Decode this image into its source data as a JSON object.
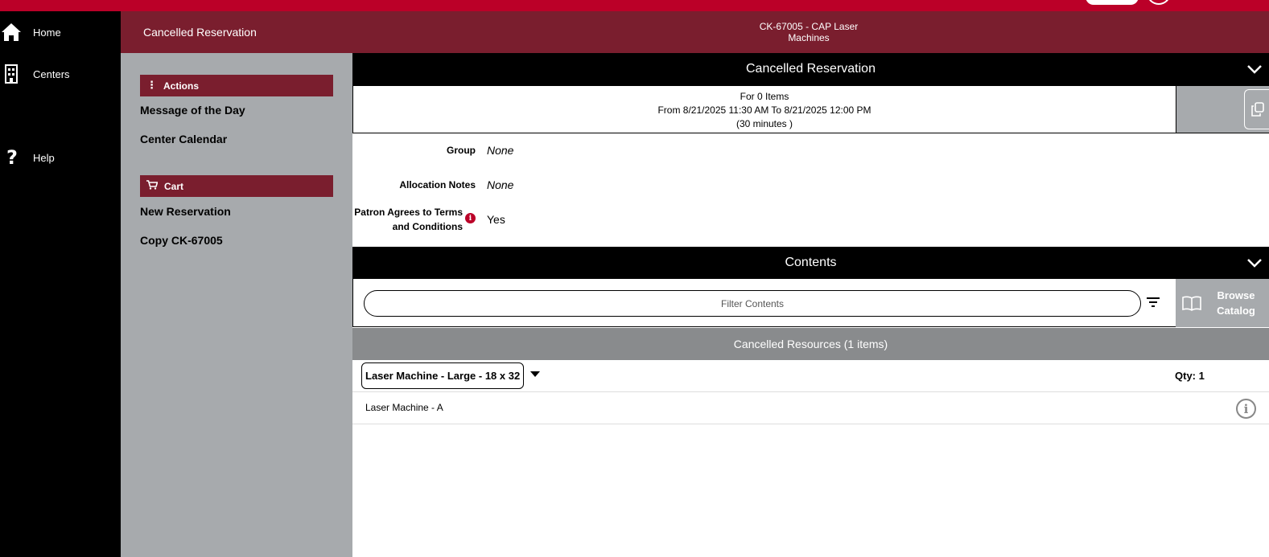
{
  "header": {
    "page_title": "Cancelled Reservation",
    "center_title": "CK-67005 - CAP Laser Machines"
  },
  "nav": {
    "items": [
      {
        "label": "Home",
        "icon": "home-icon"
      },
      {
        "label": "Centers",
        "icon": "building-icon"
      },
      {
        "label": "Help",
        "icon": "help-icon"
      }
    ]
  },
  "sidebar": {
    "actions_heading": "Actions",
    "actions": [
      "Message of the Day",
      "Center Calendar"
    ],
    "cart_heading": "Cart",
    "cart_items": [
      "New Reservation",
      "Copy CK-67005"
    ]
  },
  "reservation": {
    "section_title": "Cancelled Reservation",
    "items_line": "For 0 Items",
    "time_line": "From 8/21/2025 11:30 AM To 8/21/2025 12:00 PM",
    "duration_line": "(30 minutes )",
    "details": [
      {
        "label": "Group",
        "value": "None"
      },
      {
        "label": "Allocation Notes",
        "value": "None"
      },
      {
        "label": "Patron Agrees to Terms and Conditions",
        "value": "Yes"
      }
    ]
  },
  "contents": {
    "section_title": "Contents",
    "filter_placeholder": "Filter Contents",
    "browse_label": "Browse Catalog",
    "resources_heading": "Cancelled Resources (1 items)",
    "resource_type": "Laser Machine - Large - 18 x 32",
    "qty_label": "Qty: 1",
    "items": [
      "Laser Machine - A"
    ]
  },
  "colors": {
    "brand_red": "#bb0028",
    "header_maroon": "#7a1e2e",
    "panel_gray": "#a7aaad"
  }
}
